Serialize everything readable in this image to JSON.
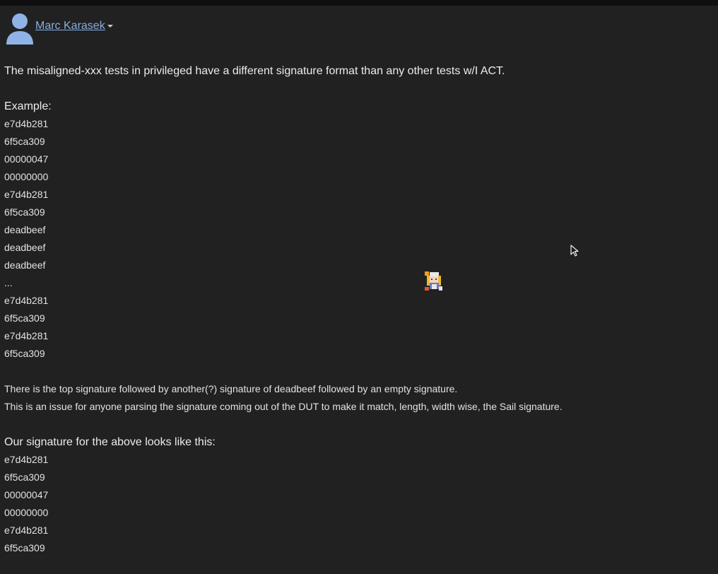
{
  "author": {
    "name": "Marc Karasek"
  },
  "post": {
    "intro": "The misaligned-xxx tests in privileged have a different signature format than any other tests w/I ACT.",
    "example_label": "Example:",
    "example_lines": [
      "e7d4b281",
      "6f5ca309",
      "00000047",
      "00000000",
      "e7d4b281",
      "6f5ca309",
      "deadbeef",
      "deadbeef",
      "deadbeef",
      "...",
      "e7d4b281",
      "6f5ca309",
      "e7d4b281",
      "6f5ca309"
    ],
    "explanation_1": "There is the top signature followed by another(?) signature of deadbeef followed by an empty signature.",
    "explanation_2": "This is an issue for anyone parsing the signature coming out of the DUT to make it match, length, width wise, the Sail signature.",
    "ours_label": "Our signature for the above looks like this:",
    "ours_lines": [
      "e7d4b281",
      "6f5ca309",
      "00000047",
      "00000000",
      "e7d4b281",
      "6f5ca309"
    ]
  },
  "icons": {
    "avatar": "user-avatar-icon",
    "dropdown": "chevron-down-icon",
    "cursor": "mouse-pointer-icon",
    "sprite": "pixel-character-sprite"
  },
  "colors": {
    "background": "#212121",
    "text": "#e6e6e6",
    "link": "#86aee0",
    "avatar": "#8fb3e6"
  }
}
